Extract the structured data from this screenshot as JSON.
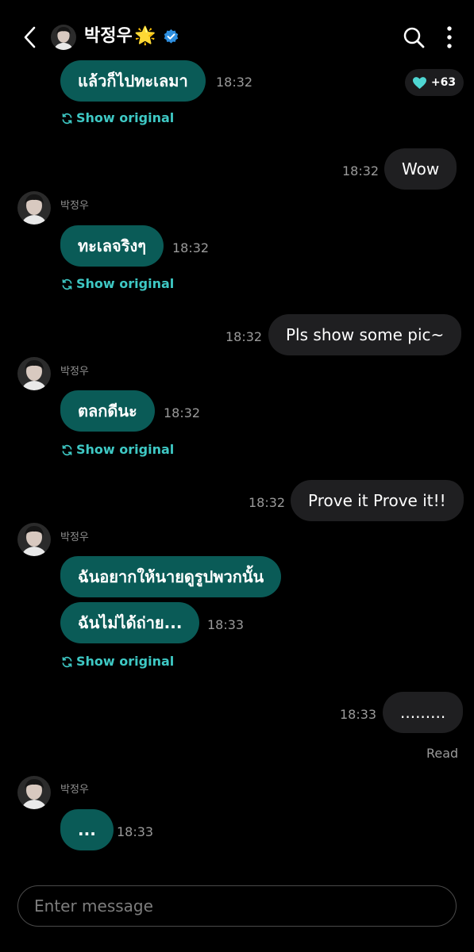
{
  "header": {
    "back_icon": "chevron-left-icon",
    "name": "박정우",
    "star": "🌟",
    "verified_icon": "verified-badge-icon",
    "search_icon": "search-icon",
    "more_icon": "more-vertical-icon"
  },
  "reaction_badge": {
    "icon": "heart-icon",
    "count": "+63",
    "color": "#4fd6d2"
  },
  "sender_name": "박정우",
  "show_original": "Show original",
  "messages": [
    {
      "dir": "in",
      "text": "แล้วก็ไปทะเลมา",
      "time": "18:32"
    },
    {
      "dir": "out",
      "text": "Wow",
      "time": "18:32"
    },
    {
      "dir": "in",
      "text": "ทะเลจริงๆ",
      "time": "18:32"
    },
    {
      "dir": "out",
      "text": "Pls show some pic~",
      "time": "18:32"
    },
    {
      "dir": "in",
      "text": "ตลกดีนะ",
      "time": "18:32"
    },
    {
      "dir": "out",
      "text": "Prove it Prove it!!",
      "time": "18:32"
    },
    {
      "dir": "in",
      "text": "ฉันอยากให้นายดูรูปพวกนั้น",
      "time": ""
    },
    {
      "dir": "in",
      "text": "ฉันไม่ได้ถ่าย...",
      "time": "18:33"
    },
    {
      "dir": "out",
      "text": ".........",
      "time": "18:33"
    },
    {
      "dir": "in",
      "text": "...",
      "time": "18:33"
    }
  ],
  "read_status": "Read",
  "input": {
    "placeholder": "Enter message",
    "value": ""
  },
  "colors": {
    "incoming": "#0a5b57",
    "outgoing": "#1f1f21",
    "accent": "#3ec8c4",
    "background": "#000000"
  }
}
